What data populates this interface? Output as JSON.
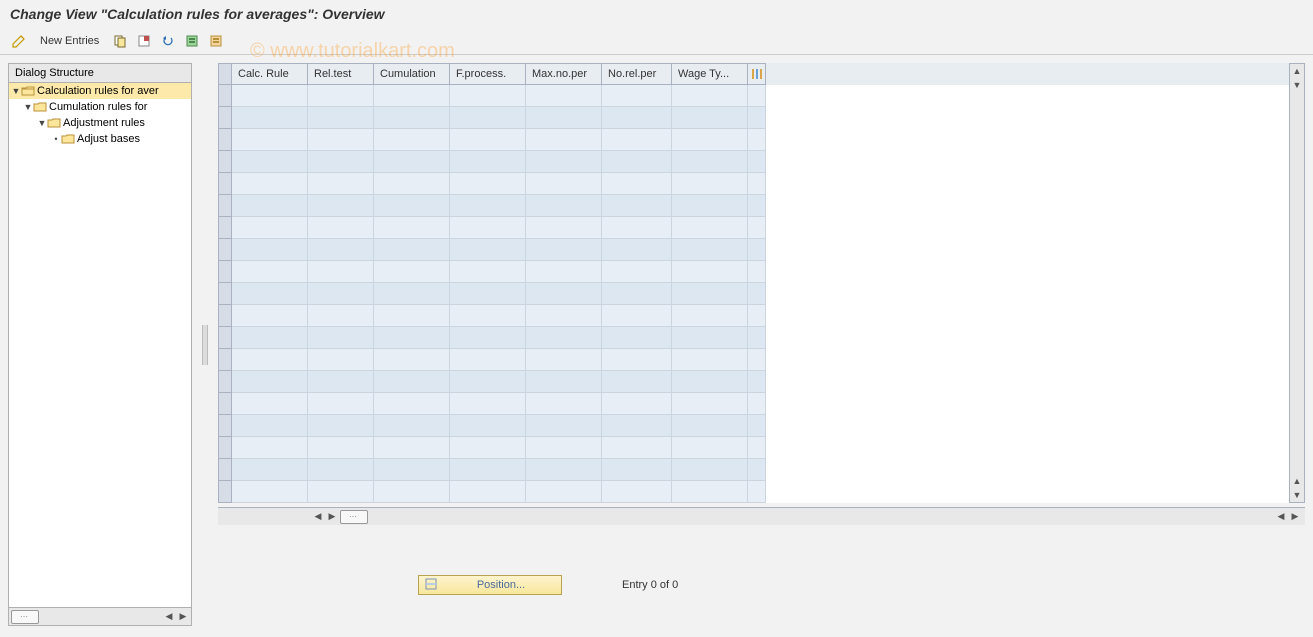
{
  "title": "Change View \"Calculation rules for averages\": Overview",
  "watermark": "© www.tutorialkart.com",
  "toolbar": {
    "new_entries": "New Entries"
  },
  "tree": {
    "header": "Dialog Structure",
    "nodes": [
      {
        "label": "Calculation rules for aver",
        "indent": 0,
        "expanded": true,
        "selected": true,
        "open": true
      },
      {
        "label": "Cumulation rules for",
        "indent": 1,
        "expanded": true,
        "selected": false,
        "open": false
      },
      {
        "label": "Adjustment rules",
        "indent": 2,
        "expanded": true,
        "selected": false,
        "open": false
      },
      {
        "label": "Adjust bases",
        "indent": 3,
        "expanded": false,
        "selected": false,
        "open": false
      }
    ]
  },
  "grid": {
    "columns": [
      "Calc. Rule",
      "Rel.test",
      "Cumulation",
      "F.process.",
      "Max.no.per",
      "No.rel.per",
      "Wage Ty..."
    ],
    "row_count": 19
  },
  "footer": {
    "position_label": "Position...",
    "entry_text": "Entry 0 of 0"
  }
}
